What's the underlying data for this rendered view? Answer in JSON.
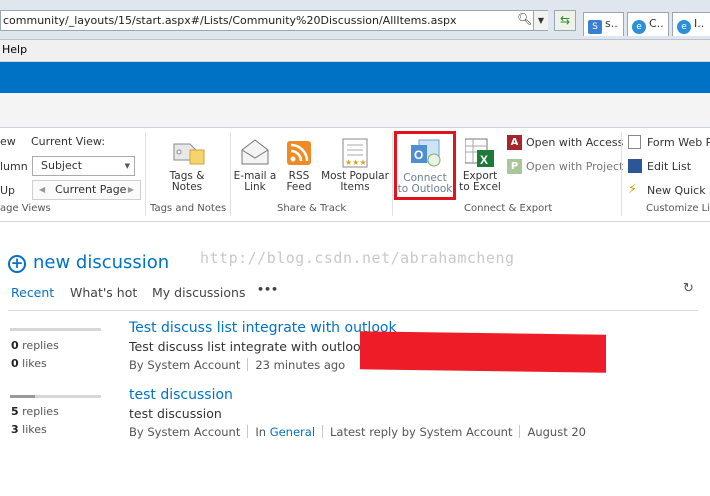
{
  "browser": {
    "url": "community/_layouts/15/start.aspx#/Lists/Community%20Discussion/AllItems.aspx",
    "tabs": [
      {
        "label": "s..",
        "icon": "sharepoint-icon",
        "color": "#3b7fd0"
      },
      {
        "label": "C..",
        "icon": "ie-icon",
        "color": "#2b8fd9"
      },
      {
        "label": "I..",
        "icon": "ie-icon",
        "color": "#2b8fd9"
      }
    ],
    "menu": {
      "help": "Help"
    }
  },
  "ribbon": {
    "manage_views": {
      "view_label": "ew",
      "column_label": "lumn",
      "up_label": "Up",
      "current_view_label": "Current View:",
      "current_view_value": "Subject",
      "current_page": "Current Page",
      "group": "age Views"
    },
    "tags_notes": {
      "button": "Tags & Notes",
      "group": "Tags and Notes"
    },
    "share_track": {
      "email": "E-mail a Link",
      "rss": "RSS Feed",
      "popular": "Most Popular Items",
      "group": "Share & Track"
    },
    "connect_export": {
      "outlook": "Connect to Outlook",
      "excel": "Export to Excel",
      "access": "Open with Access",
      "project": "Open with Project",
      "group": "Connect & Export"
    },
    "customize": {
      "form_web_parts": "Form Web Pa",
      "edit_list": "Edit List",
      "new_quick_step": "New Quick St",
      "group": "Customize Lis"
    }
  },
  "accent": "#0072c6",
  "highlight_color": "#e0141e",
  "watermark": "http://blog.csdn.net/abrahamcheng",
  "discussion": {
    "new_label": "new discussion",
    "views": [
      "Recent",
      "What's hot",
      "My discussions",
      "•••"
    ]
  },
  "posts": [
    {
      "title": "Test discuss list integrate with outlook",
      "body": "Test discuss list integrate with outlook b",
      "replies": "0",
      "replies_label": "replies",
      "likes": "0",
      "likes_label": "likes",
      "by_label": "By",
      "author": "System Account",
      "time": "23 minutes ago",
      "activity": 0
    },
    {
      "title": "test discussion",
      "body": "test discussion",
      "replies": "5",
      "replies_label": "replies",
      "likes": "3",
      "likes_label": "likes",
      "by_label": "By",
      "author": "System Account",
      "in_label": "In",
      "category": "General",
      "latest_label": "Latest reply by",
      "latest_author": "System Account",
      "date": "August 20",
      "activity": 0.27
    }
  ]
}
